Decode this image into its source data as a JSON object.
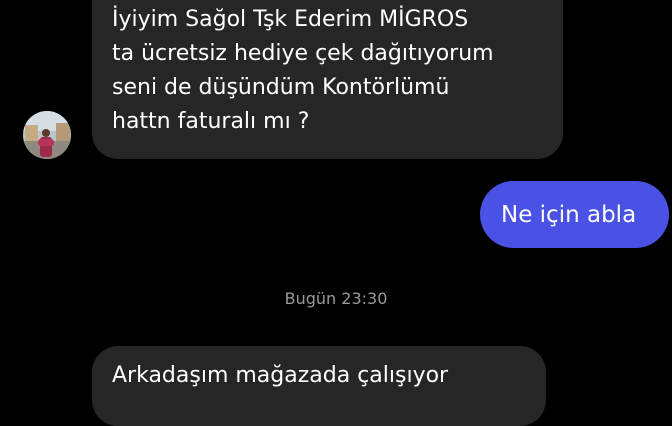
{
  "thread": {
    "messages": [
      {
        "direction": "incoming",
        "lines": [
          "İyiyim Sağol Tşk Ederim MİGROS",
          "ta ücretsiz hediye çek dağıtıyorum",
          "seni de düşündüm Kontörlümü",
          "hattn faturalı mı ?"
        ]
      },
      {
        "direction": "outgoing",
        "text": "Ne için abla"
      },
      {
        "direction": "incoming",
        "lines": [
          "Arkadaşım mağazada çalışıyor"
        ]
      }
    ],
    "timestamp": "Bugün 23:30"
  },
  "contact": {
    "avatar_icon": "contact-avatar"
  },
  "colors": {
    "background": "#000000",
    "incoming_bubble": "#262626",
    "outgoing_bubble": "#4a52e6",
    "timestamp_text": "#9a9a9a"
  }
}
